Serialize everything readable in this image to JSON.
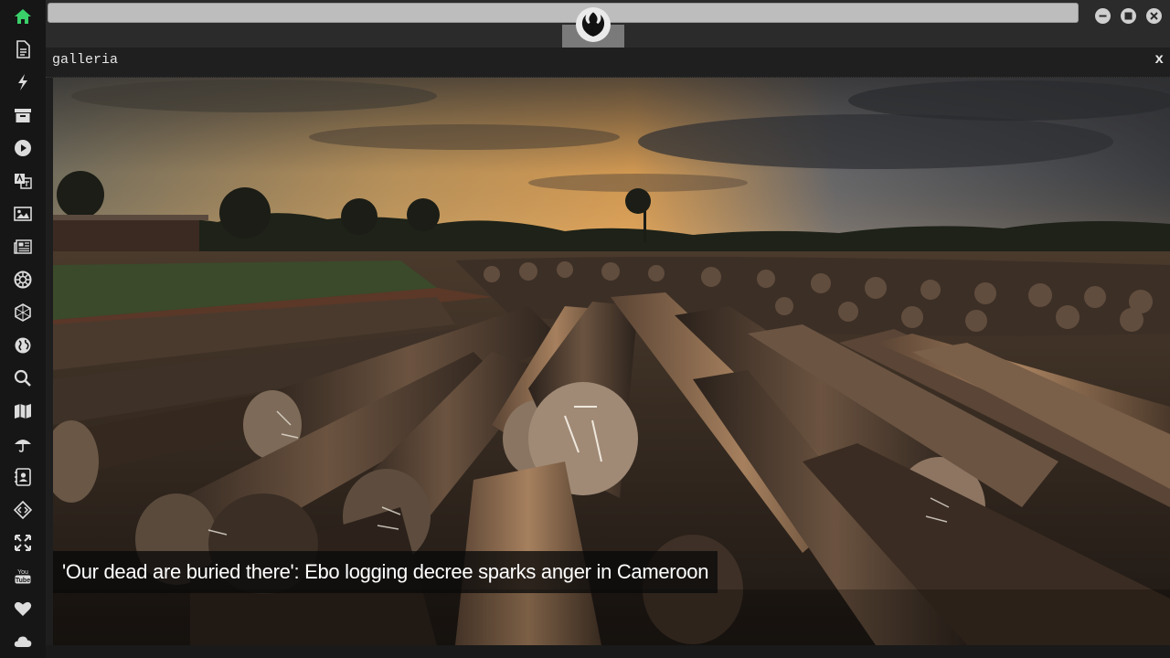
{
  "window": {
    "panel_title": "galleria",
    "close_label": "x"
  },
  "sidebar": {
    "items": [
      {
        "icon": "home-icon",
        "color": "#3ad06a"
      },
      {
        "icon": "document-icon",
        "color": "#dcdcdc"
      },
      {
        "icon": "lightning-icon",
        "color": "#dcdcdc"
      },
      {
        "icon": "archive-icon",
        "color": "#dcdcdc"
      },
      {
        "icon": "play-icon",
        "color": "#dcdcdc"
      },
      {
        "icon": "translate-icon",
        "color": "#dcdcdc"
      },
      {
        "icon": "image-icon",
        "color": "#dcdcdc"
      },
      {
        "icon": "newspaper-icon",
        "color": "#dcdcdc"
      },
      {
        "icon": "empire-icon",
        "color": "#dcdcdc"
      },
      {
        "icon": "hexagon-icon",
        "color": "#dcdcdc"
      },
      {
        "icon": "globe-icon",
        "color": "#dcdcdc"
      },
      {
        "icon": "search-icon",
        "color": "#dcdcdc"
      },
      {
        "icon": "map-icon",
        "color": "#dcdcdc"
      },
      {
        "icon": "umbrella-icon",
        "color": "#dcdcdc"
      },
      {
        "icon": "contact-card-icon",
        "color": "#dcdcdc"
      },
      {
        "icon": "code-icon",
        "color": "#dcdcdc"
      },
      {
        "icon": "expand-icon",
        "color": "#dcdcdc"
      },
      {
        "icon": "youtube-icon",
        "color": "#dcdcdc"
      },
      {
        "icon": "heart-icon",
        "color": "#dcdcdc"
      },
      {
        "icon": "cloud-icon",
        "color": "#dcdcdc"
      }
    ]
  },
  "gallery": {
    "caption": "'Our dead are buried there': Ebo logging decree sparks anger in Cameroon"
  },
  "colors": {
    "accent": "#3ad06a"
  }
}
